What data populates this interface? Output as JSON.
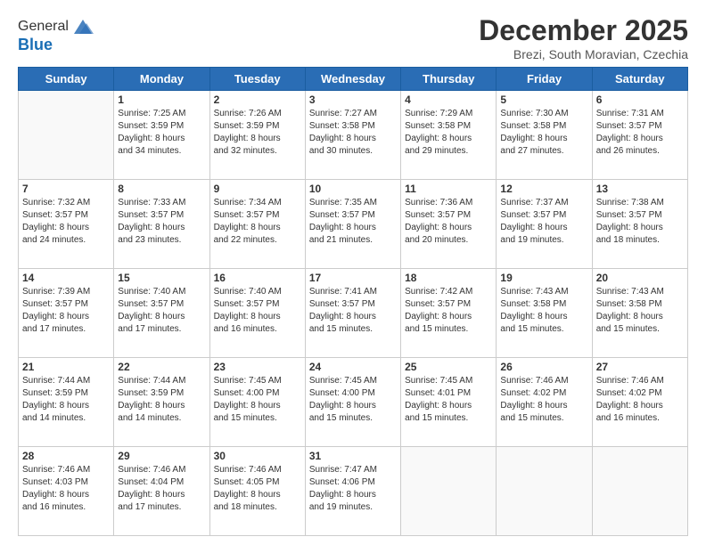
{
  "header": {
    "logo_line1": "General",
    "logo_line2": "Blue",
    "month_title": "December 2025",
    "location": "Brezi, South Moravian, Czechia"
  },
  "days_of_week": [
    "Sunday",
    "Monday",
    "Tuesday",
    "Wednesday",
    "Thursday",
    "Friday",
    "Saturday"
  ],
  "weeks": [
    [
      {
        "day": "",
        "info": ""
      },
      {
        "day": "1",
        "info": "Sunrise: 7:25 AM\nSunset: 3:59 PM\nDaylight: 8 hours\nand 34 minutes."
      },
      {
        "day": "2",
        "info": "Sunrise: 7:26 AM\nSunset: 3:59 PM\nDaylight: 8 hours\nand 32 minutes."
      },
      {
        "day": "3",
        "info": "Sunrise: 7:27 AM\nSunset: 3:58 PM\nDaylight: 8 hours\nand 30 minutes."
      },
      {
        "day": "4",
        "info": "Sunrise: 7:29 AM\nSunset: 3:58 PM\nDaylight: 8 hours\nand 29 minutes."
      },
      {
        "day": "5",
        "info": "Sunrise: 7:30 AM\nSunset: 3:58 PM\nDaylight: 8 hours\nand 27 minutes."
      },
      {
        "day": "6",
        "info": "Sunrise: 7:31 AM\nSunset: 3:57 PM\nDaylight: 8 hours\nand 26 minutes."
      }
    ],
    [
      {
        "day": "7",
        "info": "Sunrise: 7:32 AM\nSunset: 3:57 PM\nDaylight: 8 hours\nand 24 minutes."
      },
      {
        "day": "8",
        "info": "Sunrise: 7:33 AM\nSunset: 3:57 PM\nDaylight: 8 hours\nand 23 minutes."
      },
      {
        "day": "9",
        "info": "Sunrise: 7:34 AM\nSunset: 3:57 PM\nDaylight: 8 hours\nand 22 minutes."
      },
      {
        "day": "10",
        "info": "Sunrise: 7:35 AM\nSunset: 3:57 PM\nDaylight: 8 hours\nand 21 minutes."
      },
      {
        "day": "11",
        "info": "Sunrise: 7:36 AM\nSunset: 3:57 PM\nDaylight: 8 hours\nand 20 minutes."
      },
      {
        "day": "12",
        "info": "Sunrise: 7:37 AM\nSunset: 3:57 PM\nDaylight: 8 hours\nand 19 minutes."
      },
      {
        "day": "13",
        "info": "Sunrise: 7:38 AM\nSunset: 3:57 PM\nDaylight: 8 hours\nand 18 minutes."
      }
    ],
    [
      {
        "day": "14",
        "info": "Sunrise: 7:39 AM\nSunset: 3:57 PM\nDaylight: 8 hours\nand 17 minutes."
      },
      {
        "day": "15",
        "info": "Sunrise: 7:40 AM\nSunset: 3:57 PM\nDaylight: 8 hours\nand 17 minutes."
      },
      {
        "day": "16",
        "info": "Sunrise: 7:40 AM\nSunset: 3:57 PM\nDaylight: 8 hours\nand 16 minutes."
      },
      {
        "day": "17",
        "info": "Sunrise: 7:41 AM\nSunset: 3:57 PM\nDaylight: 8 hours\nand 15 minutes."
      },
      {
        "day": "18",
        "info": "Sunrise: 7:42 AM\nSunset: 3:57 PM\nDaylight: 8 hours\nand 15 minutes."
      },
      {
        "day": "19",
        "info": "Sunrise: 7:43 AM\nSunset: 3:58 PM\nDaylight: 8 hours\nand 15 minutes."
      },
      {
        "day": "20",
        "info": "Sunrise: 7:43 AM\nSunset: 3:58 PM\nDaylight: 8 hours\nand 15 minutes."
      }
    ],
    [
      {
        "day": "21",
        "info": "Sunrise: 7:44 AM\nSunset: 3:59 PM\nDaylight: 8 hours\nand 14 minutes."
      },
      {
        "day": "22",
        "info": "Sunrise: 7:44 AM\nSunset: 3:59 PM\nDaylight: 8 hours\nand 14 minutes."
      },
      {
        "day": "23",
        "info": "Sunrise: 7:45 AM\nSunset: 4:00 PM\nDaylight: 8 hours\nand 15 minutes."
      },
      {
        "day": "24",
        "info": "Sunrise: 7:45 AM\nSunset: 4:00 PM\nDaylight: 8 hours\nand 15 minutes."
      },
      {
        "day": "25",
        "info": "Sunrise: 7:45 AM\nSunset: 4:01 PM\nDaylight: 8 hours\nand 15 minutes."
      },
      {
        "day": "26",
        "info": "Sunrise: 7:46 AM\nSunset: 4:02 PM\nDaylight: 8 hours\nand 15 minutes."
      },
      {
        "day": "27",
        "info": "Sunrise: 7:46 AM\nSunset: 4:02 PM\nDaylight: 8 hours\nand 16 minutes."
      }
    ],
    [
      {
        "day": "28",
        "info": "Sunrise: 7:46 AM\nSunset: 4:03 PM\nDaylight: 8 hours\nand 16 minutes."
      },
      {
        "day": "29",
        "info": "Sunrise: 7:46 AM\nSunset: 4:04 PM\nDaylight: 8 hours\nand 17 minutes."
      },
      {
        "day": "30",
        "info": "Sunrise: 7:46 AM\nSunset: 4:05 PM\nDaylight: 8 hours\nand 18 minutes."
      },
      {
        "day": "31",
        "info": "Sunrise: 7:47 AM\nSunset: 4:06 PM\nDaylight: 8 hours\nand 19 minutes."
      },
      {
        "day": "",
        "info": ""
      },
      {
        "day": "",
        "info": ""
      },
      {
        "day": "",
        "info": ""
      }
    ]
  ]
}
